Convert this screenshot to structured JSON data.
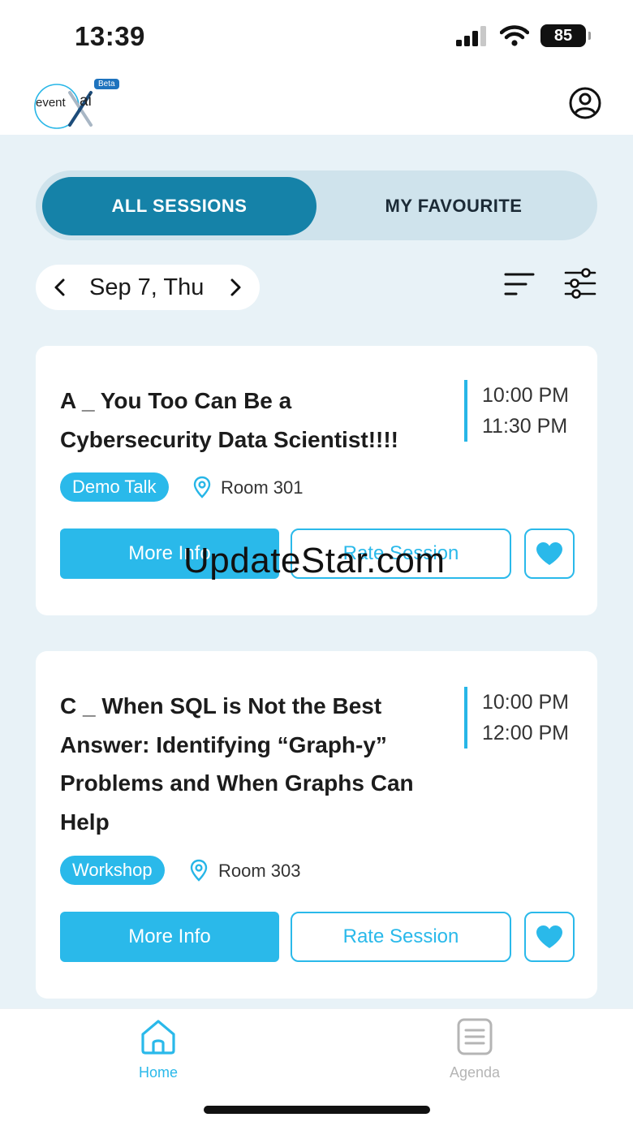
{
  "status_bar": {
    "time": "13:39",
    "battery": "85"
  },
  "header": {
    "logo_text": "event",
    "logo_ai": "ai",
    "beta_badge": "Beta"
  },
  "tabs": [
    {
      "label": "ALL SESSIONS",
      "selected": true
    },
    {
      "label": "MY FAVOURITE",
      "selected": false
    }
  ],
  "date_selector": {
    "label": "Sep 7, Thu"
  },
  "sessions": [
    {
      "title": "A _ You Too Can Be a Cybersecurity Data Scientist!!!!",
      "start_time": "10:00 PM",
      "end_time": "11:30 PM",
      "tag": "Demo Talk",
      "room": "Room 301",
      "more_info_label": "More Info",
      "rate_label": "Rate Session"
    },
    {
      "title": "C _ When SQL is Not the Best Answer: Identifying “Graph-y” Problems and When Graphs Can Help",
      "start_time": "10:00 PM",
      "end_time": "12:00 PM",
      "tag": "Workshop",
      "room": "Room 303",
      "more_info_label": "More Info",
      "rate_label": "Rate Session"
    }
  ],
  "watermark": "UpdateStar.com",
  "bottom_nav": [
    {
      "label": "Home",
      "icon": "home-icon",
      "active": true
    },
    {
      "label": "Agenda",
      "icon": "agenda-icon",
      "active": false
    }
  ],
  "colors": {
    "accent": "#2ab9ea",
    "tab_active": "#1582a8",
    "background": "#e8f2f7",
    "nav_inactive": "#b5b5b5"
  }
}
